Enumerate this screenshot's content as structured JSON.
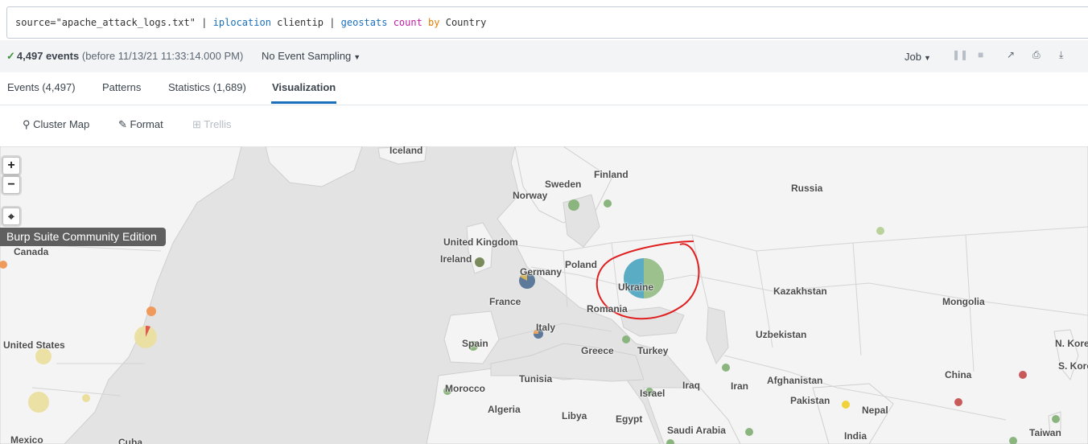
{
  "search": {
    "src_key": "source=",
    "src_val": "\"apache_attack_logs.txt\"",
    "pipe": "|",
    "cmd1": "iplocation",
    "arg1": "clientip",
    "cmd2": "geostats",
    "fn": "count",
    "kw": "by",
    "arg2": "Country"
  },
  "status": {
    "events": "4,497 events",
    "before": "(before 11/13/21 11:33:14.000 PM)",
    "sampling": "No Event Sampling",
    "job": "Job"
  },
  "tabs": [
    "Events (4,497)",
    "Patterns",
    "Statistics (1,689)",
    "Visualization"
  ],
  "viz": {
    "cluster": "Cluster Map",
    "format": "Format",
    "trellis": "Trellis"
  },
  "map": {
    "zoom_in": "+",
    "zoom_out": "−",
    "labels": [
      "Iceland",
      "Finland",
      "Sweden",
      "Norway",
      "Russia",
      "United Kingdom",
      "Ireland",
      "Germany",
      "Poland",
      "Ukraine",
      "Kazakhstan",
      "Mongolia",
      "France",
      "Romania",
      "Canada",
      "United States",
      "Italy",
      "Uzbekistan",
      "N. Korea",
      "Spain",
      "Greece",
      "Turkey",
      "China",
      "S. Kore",
      "Tunisia",
      "Afghanistan",
      "Iraq",
      "Iran",
      "Morocco",
      "Israel",
      "Pakistan",
      "Algeria",
      "Nepal",
      "Libya",
      "Egypt",
      "Saudi Arabia",
      "Taiwan",
      "India",
      "Mexico",
      "Cuba"
    ],
    "tooltip": "Burp Suite Community Edition"
  },
  "colors": {
    "accent": "#1a6fbd",
    "annotation": "#e02020",
    "map_bg": "#e3e3e3"
  }
}
